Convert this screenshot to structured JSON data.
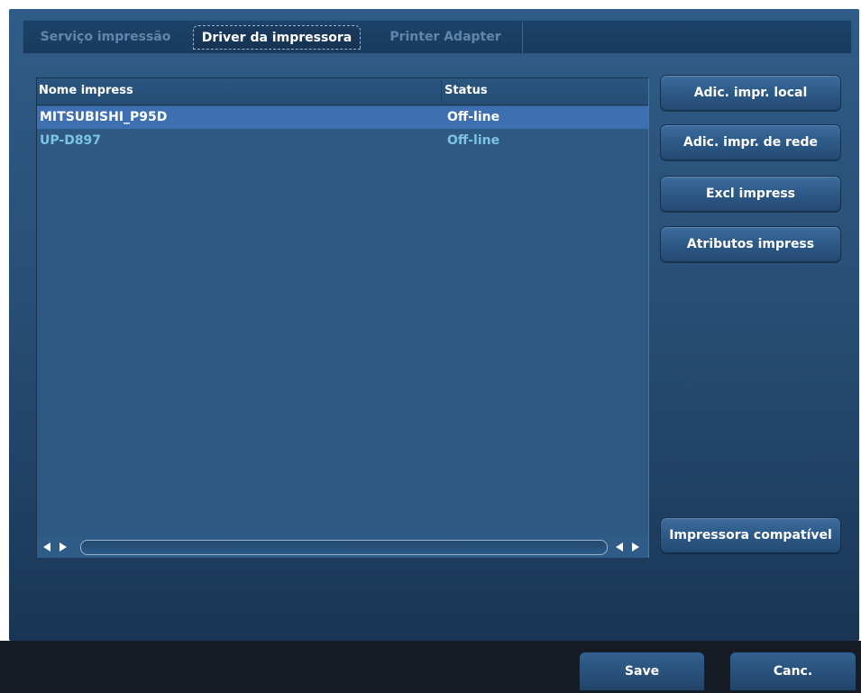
{
  "tabs": [
    {
      "label": "Serviço impressão",
      "active": false
    },
    {
      "label": "Driver da impressora",
      "active": true
    },
    {
      "label": "Printer Adapter",
      "active": false
    }
  ],
  "printer_list": {
    "columns": [
      "Nome impress",
      "Status"
    ],
    "rows": [
      {
        "name": "MITSUBISHI_P95D",
        "status": "Off-line",
        "selected": true
      },
      {
        "name": "UP-D897",
        "status": "Off-line",
        "selected": false
      }
    ]
  },
  "side_buttons": {
    "add_local": "Adic. impr. local",
    "add_network": "Adic. impr. de rede",
    "delete": "Excl impress",
    "attributes": "Atributos impress",
    "compatible": "Impressora compatível"
  },
  "footer": {
    "save": "Save",
    "cancel": "Canc."
  },
  "colors": {
    "panel": "#2d5982",
    "selected_row": "#3e6fb0",
    "row_text": "#7cc3e6",
    "bottom_bar": "#161b23"
  }
}
